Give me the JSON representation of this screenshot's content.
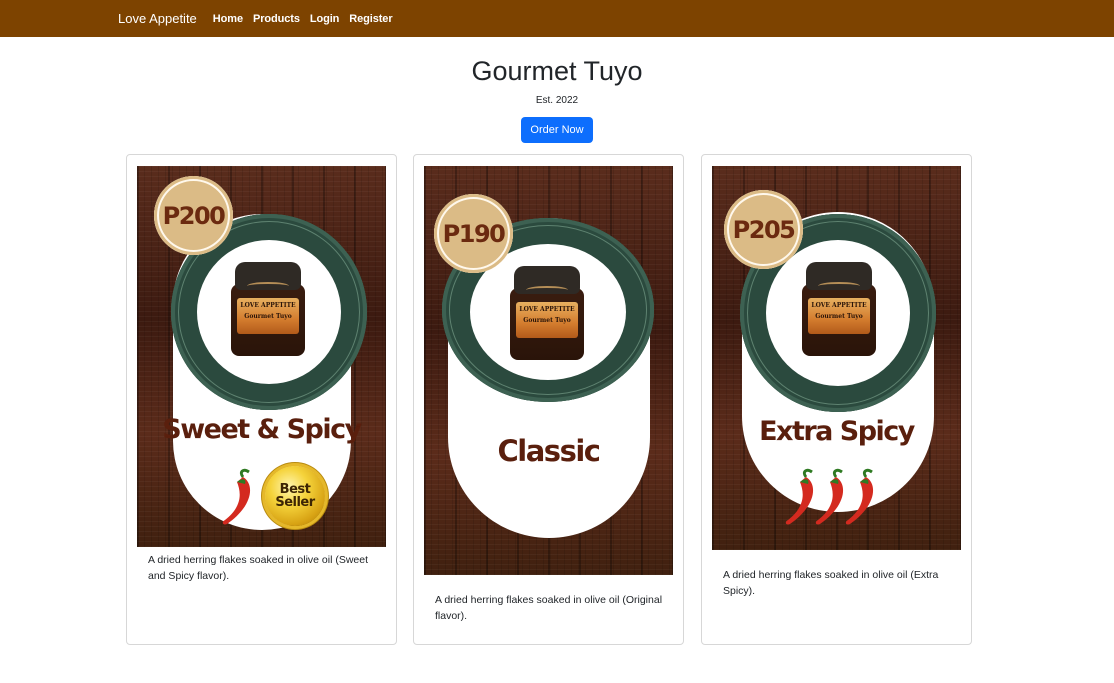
{
  "navbar": {
    "brand": "Love Appetite",
    "links": [
      "Home",
      "Products",
      "Login",
      "Register"
    ]
  },
  "hero": {
    "title": "Gourmet Tuyo",
    "subtitle": "Est. 2022",
    "cta": "Order Now"
  },
  "products": [
    {
      "price": "P200",
      "flavor": "Sweet & Spicy",
      "chili_count": 1,
      "best_seller_line1": "Best",
      "best_seller_line2": "Seller",
      "description": "A dried herring flakes soaked in olive oil (Sweet and Spicy flavor).",
      "jar_brand": "LOVE APPETITE",
      "jar_name": "Gourmet Tuyo"
    },
    {
      "price": "P190",
      "flavor": "Classic",
      "chili_count": 0,
      "description": "A dried herring flakes soaked in olive oil (Original flavor).",
      "jar_brand": "LOVE APPETITE",
      "jar_name": "Gourmet Tuyo"
    },
    {
      "price": "P205",
      "flavor": "Extra Spicy",
      "chili_count": 3,
      "description": "A dried herring flakes soaked in olive oil (Extra Spicy).",
      "jar_brand": "LOVE APPETITE",
      "jar_name": "Gourmet Tuyo"
    }
  ],
  "colors": {
    "navbar": "#7d4300",
    "button": "#0d6efd",
    "badge": "#dbbb86",
    "ring": "#2b4a3e",
    "flavor_text": "#5a1f0d",
    "chili": "#d42a1f"
  },
  "icons": [
    "chili-pepper-icon",
    "best-seller-seal-icon"
  ]
}
